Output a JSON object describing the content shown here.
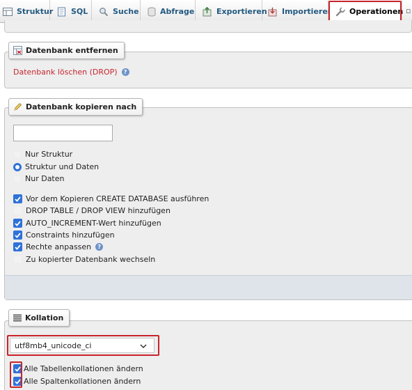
{
  "tabs": [
    {
      "label": "Struktur",
      "icon": "structure-icon"
    },
    {
      "label": "SQL",
      "icon": "sql-icon"
    },
    {
      "label": "Suche",
      "icon": "search-icon"
    },
    {
      "label": "Abfrage",
      "icon": "query-icon"
    },
    {
      "label": "Exportieren",
      "icon": "export-icon"
    },
    {
      "label": "Importieren",
      "icon": "import-icon"
    },
    {
      "label": "Operationen",
      "icon": "wrench-icon",
      "active": true
    }
  ],
  "drop_section": {
    "legend": "Datenbank entfernen",
    "drop_link": "Datenbank löschen (DROP)"
  },
  "copy_section": {
    "legend": "Datenbank kopieren nach",
    "new_name_value": "",
    "radios": [
      {
        "label": "Nur Struktur",
        "checked": false
      },
      {
        "label": "Struktur und Daten",
        "checked": true
      },
      {
        "label": "Nur Daten",
        "checked": false
      }
    ],
    "checkboxes": [
      {
        "label": "Vor dem Kopieren CREATE DATABASE ausführen",
        "checked": true
      },
      {
        "label": "DROP TABLE / DROP VIEW hinzufügen",
        "checked": false
      },
      {
        "label": "AUTO_INCREMENT-Wert hinzufügen",
        "checked": true
      },
      {
        "label": "Constraints hinzufügen",
        "checked": true
      },
      {
        "label": "Rechte anpassen",
        "checked": true
      },
      {
        "label": "Zu kopierter Datenbank wechseln",
        "checked": false
      }
    ]
  },
  "collation_section": {
    "legend": "Kollation",
    "selected": "utf8mb4_unicode_ci",
    "checkboxes": [
      {
        "label": "Alle Tabellenkollationen ändern",
        "checked": true
      },
      {
        "label": "Alle Spaltenkollationen ändern",
        "checked": true
      }
    ]
  },
  "colors": {
    "link": "#c5252e",
    "tab_text": "#235a81",
    "highlight": "#c9242b",
    "checkbox": "#2f72d8"
  }
}
